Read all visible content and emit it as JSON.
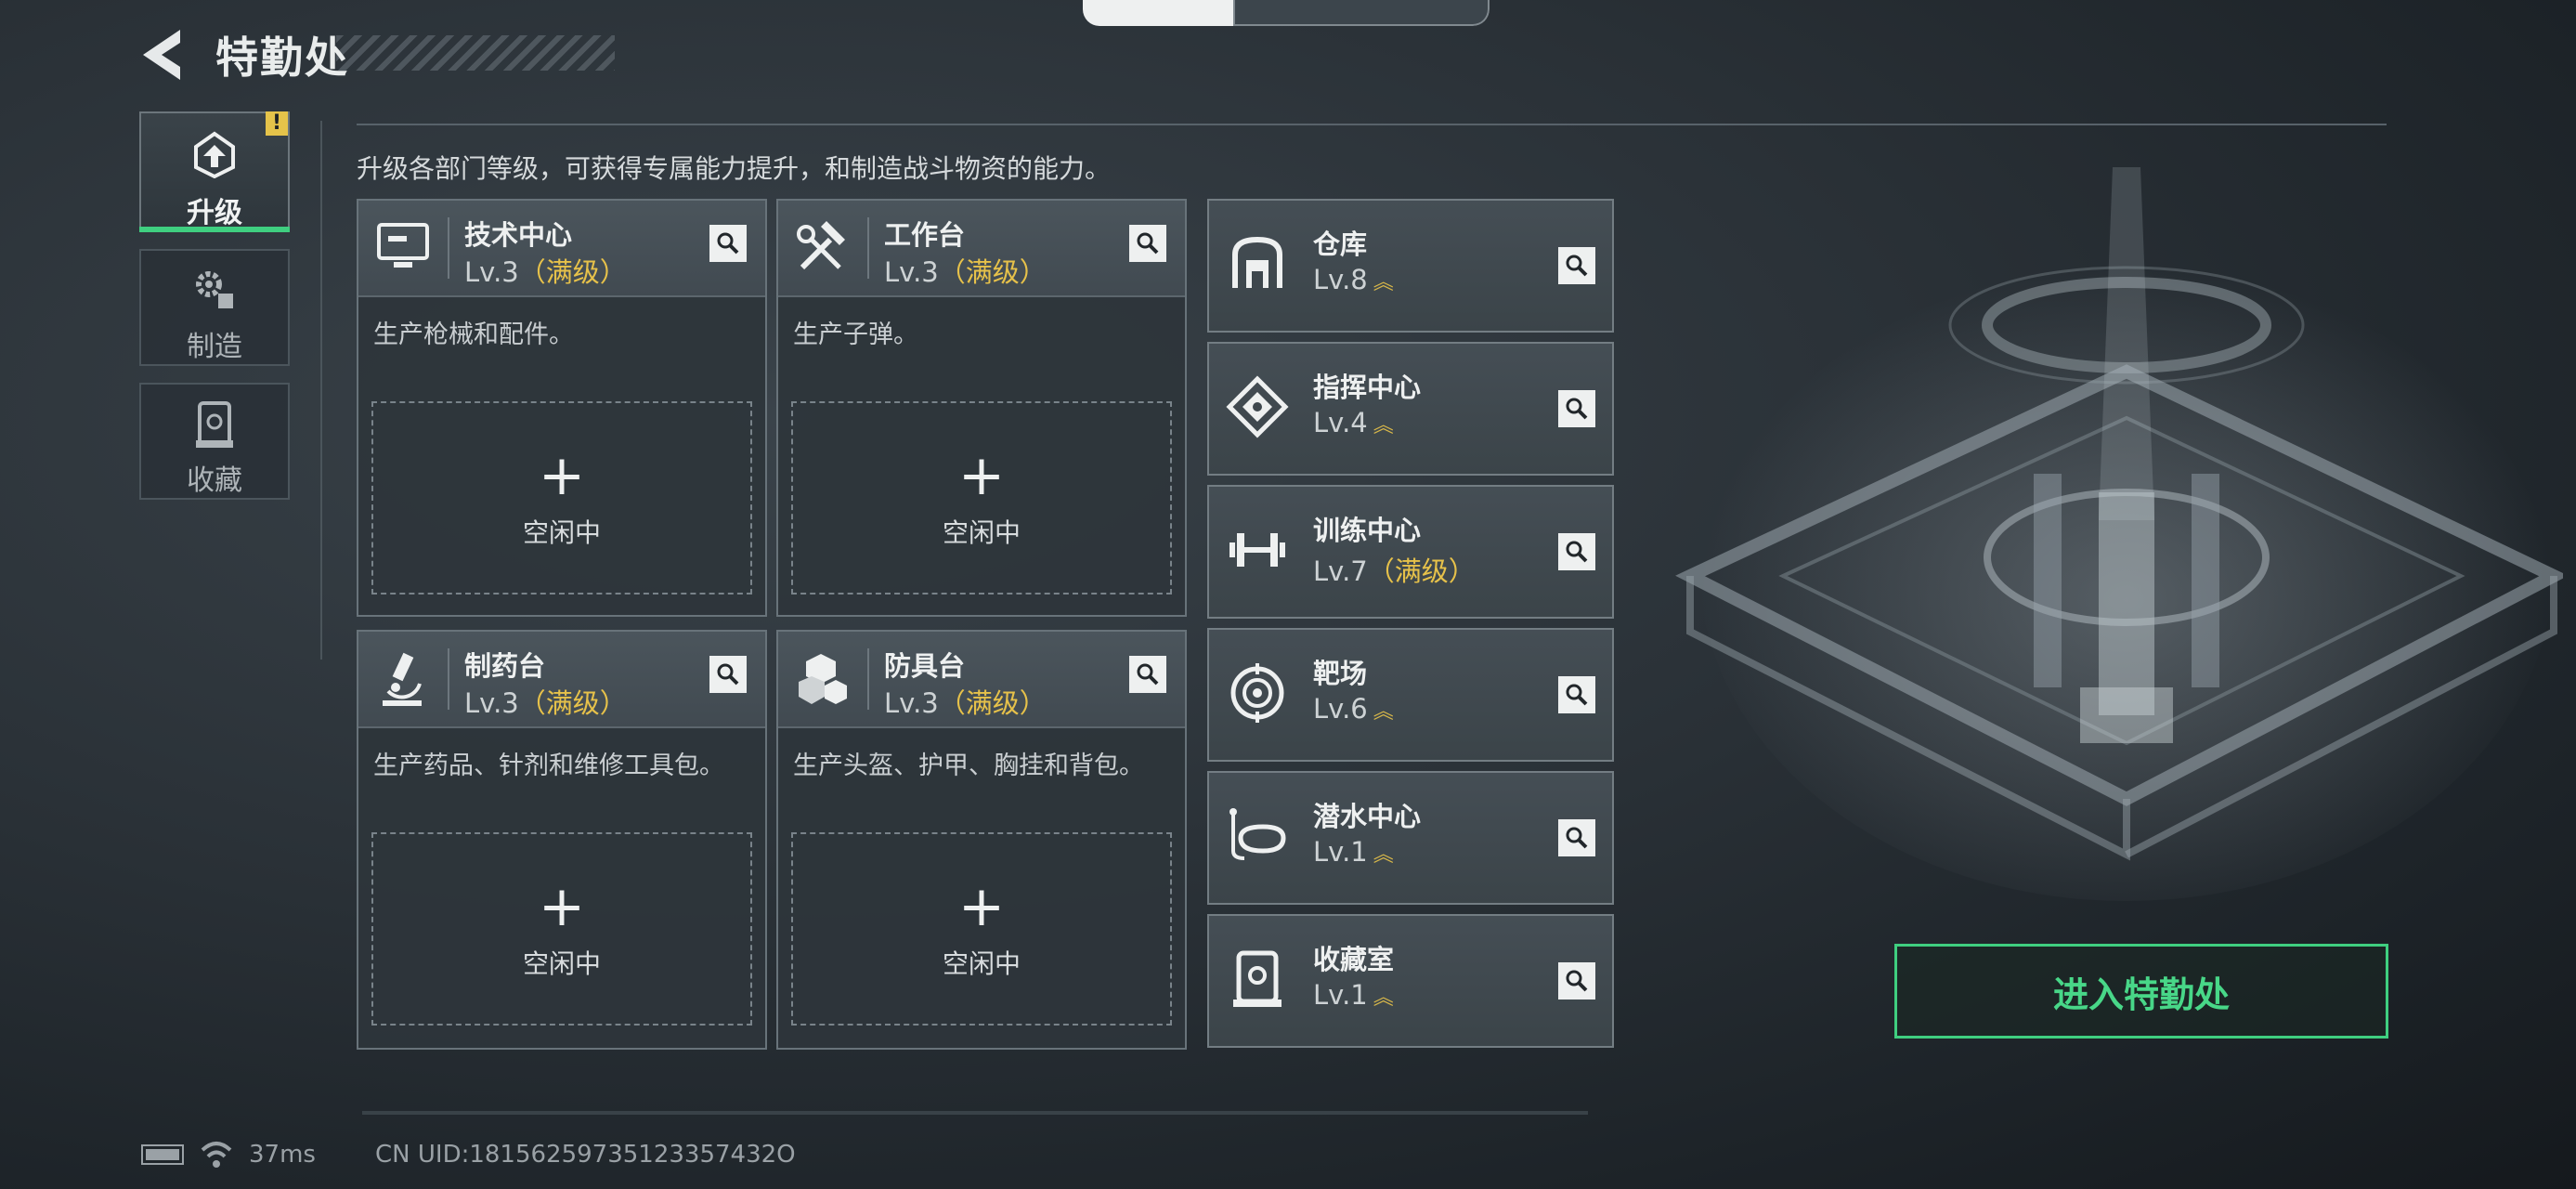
{
  "header": {
    "title": "特勤处"
  },
  "nav": {
    "items": [
      {
        "label": "升级",
        "active": true,
        "badge": "!"
      },
      {
        "label": "制造",
        "active": false
      },
      {
        "label": "收藏",
        "active": false
      }
    ]
  },
  "description": "升级各部门等级，可获得专属能力提升，和制造战斗物资的能力。",
  "work_cards": [
    {
      "name": "技术中心",
      "level": "Lv.3",
      "max": "（满级）",
      "desc": "生产枪械和配件。",
      "slot_status": "空闲中",
      "icon": "monitor-icon"
    },
    {
      "name": "工作台",
      "level": "Lv.3",
      "max": "（满级）",
      "desc": "生产子弹。",
      "slot_status": "空闲中",
      "icon": "tools-icon"
    },
    {
      "name": "制药台",
      "level": "Lv.3",
      "max": "（满级）",
      "desc": "生产药品、针剂和维修工具包。",
      "slot_status": "空闲中",
      "icon": "microscope-icon"
    },
    {
      "name": "防具台",
      "level": "Lv.3",
      "max": "（满级）",
      "desc": "生产头盔、护甲、胸挂和背包。",
      "slot_status": "空闲中",
      "icon": "armor-icon"
    }
  ],
  "side_cards": [
    {
      "name": "仓库",
      "level": "Lv.8",
      "max": "",
      "upgradable": true,
      "icon": "warehouse-icon"
    },
    {
      "name": "指挥中心",
      "level": "Lv.4",
      "max": "",
      "upgradable": true,
      "icon": "command-icon"
    },
    {
      "name": "训练中心",
      "level": "Lv.7",
      "max": "（满级）",
      "upgradable": false,
      "icon": "dumbbell-icon"
    },
    {
      "name": "靶场",
      "level": "Lv.6",
      "max": "",
      "upgradable": true,
      "icon": "target-icon"
    },
    {
      "name": "潜水中心",
      "level": "Lv.1",
      "max": "",
      "upgradable": true,
      "icon": "diving-mask-icon"
    },
    {
      "name": "收藏室",
      "level": "Lv.1",
      "max": "",
      "upgradable": true,
      "icon": "collection-icon"
    }
  ],
  "enter_button": "进入特勤处",
  "status_bar": {
    "ping": "37ms",
    "uid": "CN UID:18156259735123357432O"
  },
  "colors": {
    "accent_green": "#3fcf80",
    "max_gold": "#e6c14a",
    "badge_yellow": "#e5c34a"
  }
}
